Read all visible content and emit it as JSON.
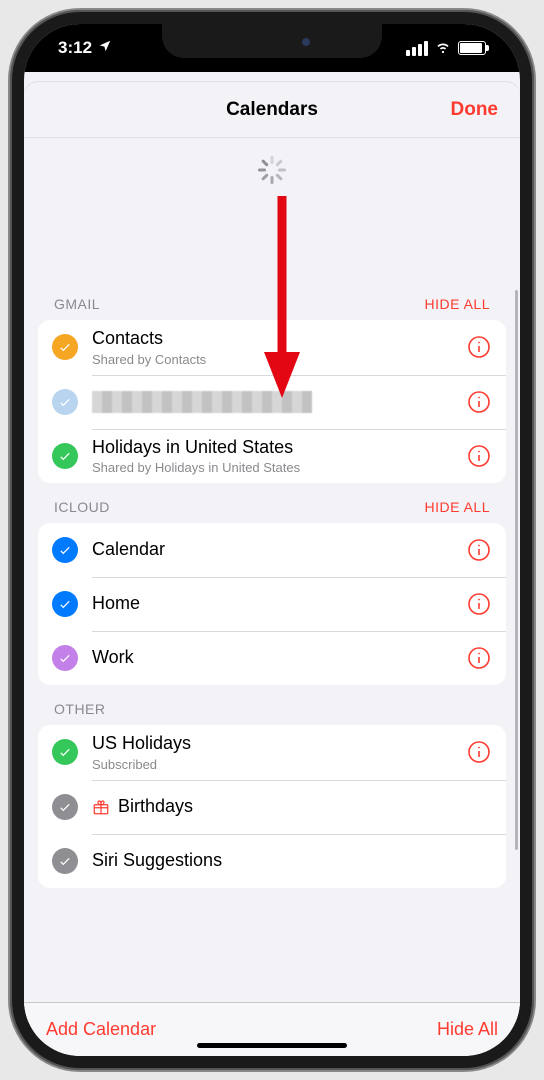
{
  "status": {
    "time": "3:12"
  },
  "header": {
    "title": "Calendars",
    "done": "Done"
  },
  "colors": {
    "accent": "#ff3b30",
    "orange": "#f5a623",
    "lightblue": "#b9d4ef",
    "green": "#34c759",
    "blue": "#007aff",
    "purple": "#c280e8",
    "gray": "#8e8e93"
  },
  "sections": [
    {
      "id": "gmail",
      "title": "GMAIL",
      "hide_label": "HIDE ALL",
      "items": [
        {
          "label": "Contacts",
          "sub": "Shared by Contacts",
          "color": "orange",
          "info": true,
          "redacted": false
        },
        {
          "label": "",
          "sub": "",
          "color": "lightblue",
          "info": true,
          "redacted": true
        },
        {
          "label": "Holidays in United States",
          "sub": "Shared by Holidays in United States",
          "color": "green",
          "info": true,
          "redacted": false
        }
      ]
    },
    {
      "id": "icloud",
      "title": "ICLOUD",
      "hide_label": "HIDE ALL",
      "items": [
        {
          "label": "Calendar",
          "color": "blue",
          "info": true
        },
        {
          "label": "Home",
          "color": "blue",
          "info": true
        },
        {
          "label": "Work",
          "color": "purple",
          "info": true
        }
      ]
    },
    {
      "id": "other",
      "title": "OTHER",
      "hide_label": "",
      "items": [
        {
          "label": "US Holidays",
          "sub": "Subscribed",
          "color": "green",
          "info": true
        },
        {
          "label": "Birthdays",
          "color": "gray",
          "info": false,
          "icon": "gift"
        },
        {
          "label": "Siri Suggestions",
          "color": "gray",
          "info": false
        }
      ]
    }
  ],
  "toolbar": {
    "add": "Add Calendar",
    "hide_all": "Hide All"
  }
}
